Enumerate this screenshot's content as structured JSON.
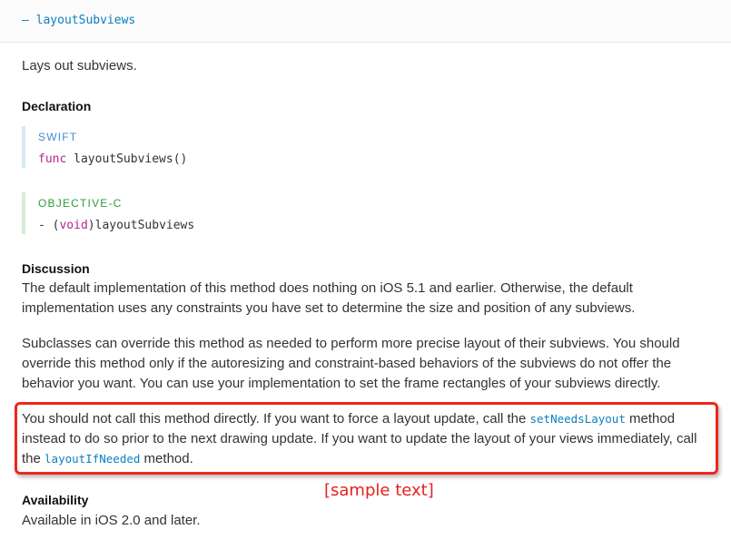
{
  "header": {
    "method_title": "– layoutSubviews"
  },
  "abstract": "Lays out subviews.",
  "declaration": {
    "heading": "Declaration",
    "swift": {
      "label": "SWIFT",
      "keyword": "func",
      "signature": " layoutSubviews()"
    },
    "objc": {
      "label": "OBJECTIVE-C",
      "prefix": "- (",
      "keyword": "void",
      "signature": ")layoutSubviews"
    }
  },
  "discussion": {
    "heading": "Discussion",
    "p1": "The default implementation of this method does nothing on iOS 5.1 and earlier. Otherwise, the default implementation uses any constraints you have set to determine the size and position of any subviews.",
    "p2": "Subclasses can override this method as needed to perform more precise layout of their subviews. You should override this method only if the autoresizing and constraint-based behaviors of the subviews do not offer the behavior you want. You can use your implementation to set the frame rectangles of your subviews directly.",
    "p3": {
      "part1": "You should not call this method directly. If you want to force a layout update, call the ",
      "link1": "setNeedsLayout",
      "part2": " method instead to do so prior to the next drawing update. If you want to update the layout of your views immediately, call the ",
      "link2": "layoutIfNeeded",
      "part3": " method."
    }
  },
  "availability": {
    "heading": "Availability",
    "text": "Available in iOS 2.0 and later."
  },
  "annotation": {
    "text": "[sample text]"
  },
  "colors": {
    "link": "#0b7fbd",
    "highlight_border": "#f0261e",
    "annotation": "#e82020",
    "keyword": "#b4278d"
  }
}
